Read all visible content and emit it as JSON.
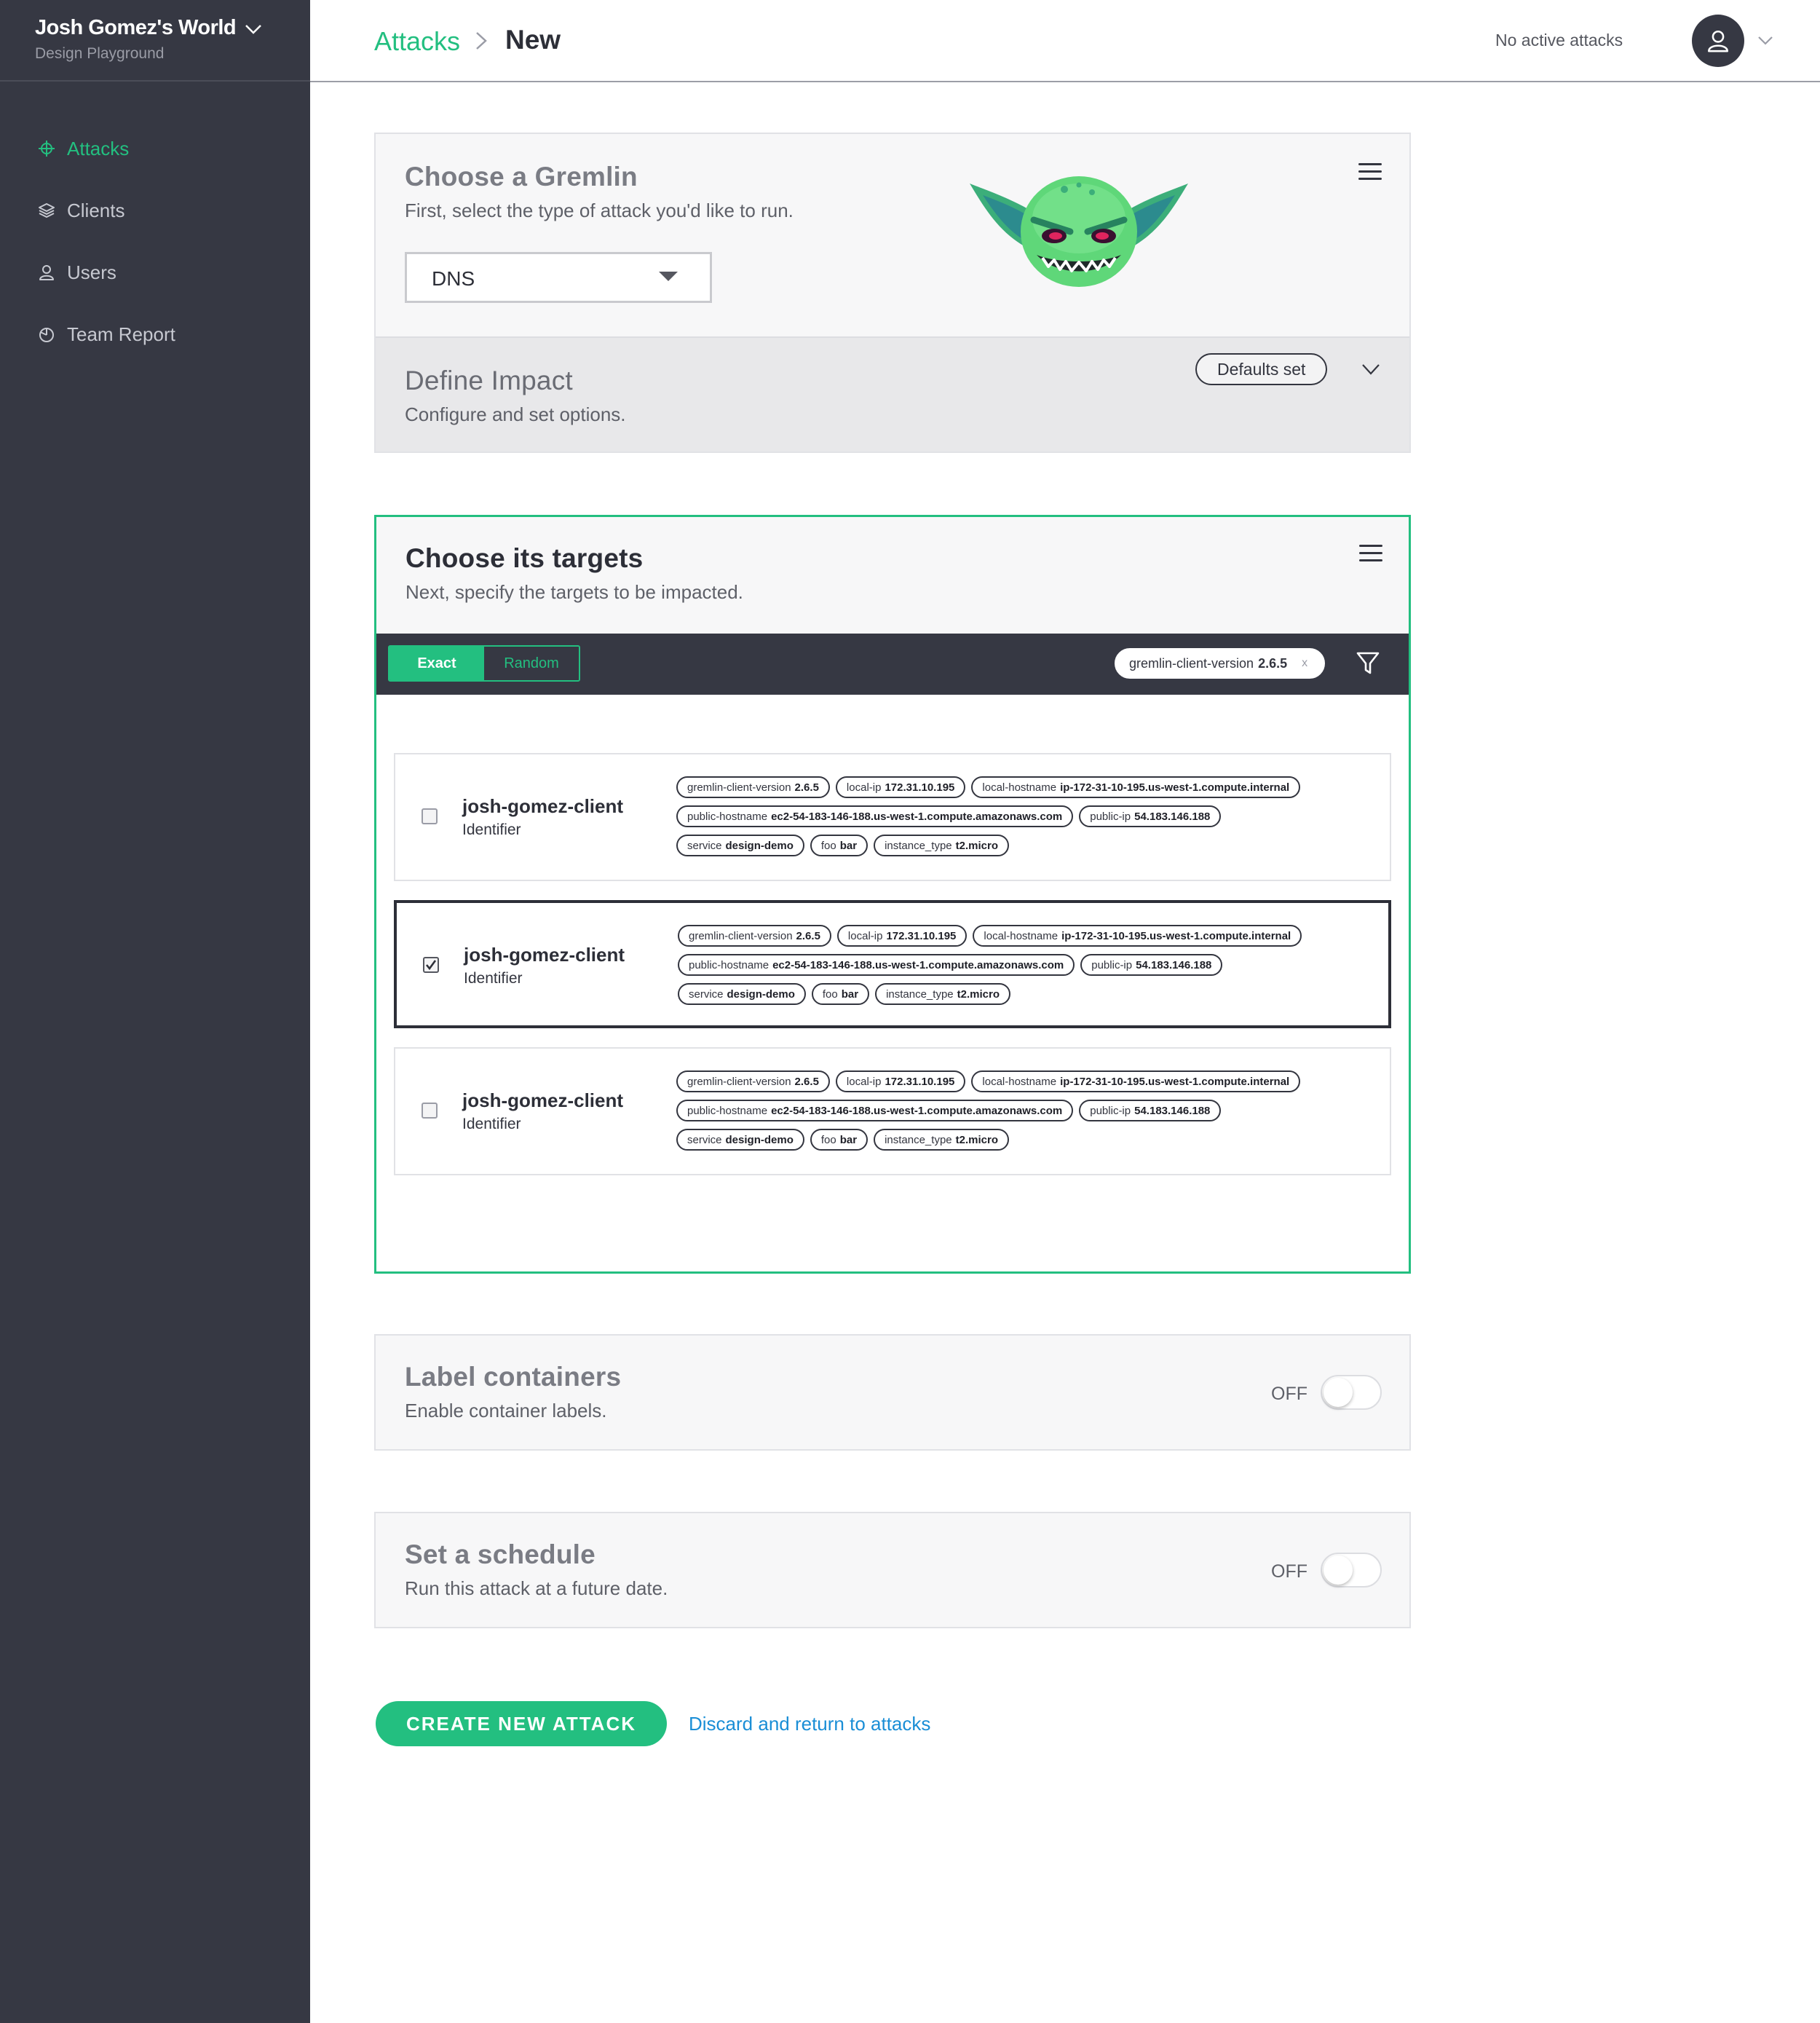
{
  "sidebar": {
    "workspace_title": "Josh Gomez's World",
    "workspace_subtitle": "Design Playground",
    "items": [
      {
        "label": "Attacks",
        "icon": "crosshair-icon",
        "active": true
      },
      {
        "label": "Clients",
        "icon": "layers-icon",
        "active": false
      },
      {
        "label": "Users",
        "icon": "users-icon",
        "active": false
      },
      {
        "label": "Team Report",
        "icon": "pie-chart-icon",
        "active": false
      }
    ]
  },
  "header": {
    "breadcrumb_root": "Attacks",
    "breadcrumb_current": "New",
    "status": "No active attacks",
    "avatar_icon": "user-icon"
  },
  "gremlin_card": {
    "title": "Choose a Gremlin",
    "subtitle": "First, select the type of attack you'd like to run.",
    "selected_type": "DNS",
    "mascot_icon": "gremlin-mascot-icon"
  },
  "impact": {
    "title": "Define Impact",
    "subtitle": "Configure and set options.",
    "badge": "Defaults set"
  },
  "targets_card": {
    "title": "Choose its targets",
    "subtitle": "Next, specify the targets to be impacted.",
    "mode_exact": "Exact",
    "mode_random": "Random",
    "filter_chip": {
      "key": "gremlin-client-version",
      "value": "2.6.5",
      "close": "x"
    },
    "targets": [
      {
        "name": "josh-gomez-client",
        "kind": "Identifier",
        "checked": false,
        "tag_rows": [
          [
            {
              "k": "gremlin-client-version",
              "v": "2.6.5"
            },
            {
              "k": "local-ip",
              "v": "172.31.10.195"
            },
            {
              "k": "local-hostname",
              "v": "ip-172-31-10-195.us-west-1.compute.internal"
            }
          ],
          [
            {
              "k": "public-hostname",
              "v": "ec2-54-183-146-188.us-west-1.compute.amazonaws.com"
            },
            {
              "k": "public-ip",
              "v": "54.183.146.188"
            }
          ],
          [
            {
              "k": "service",
              "v": "design-demo"
            },
            {
              "k": "foo",
              "v": "bar"
            },
            {
              "k": "instance_type",
              "v": "t2.micro"
            }
          ]
        ]
      },
      {
        "name": "josh-gomez-client",
        "kind": "Identifier",
        "checked": true,
        "tag_rows": [
          [
            {
              "k": "gremlin-client-version",
              "v": "2.6.5"
            },
            {
              "k": "local-ip",
              "v": "172.31.10.195"
            },
            {
              "k": "local-hostname",
              "v": "ip-172-31-10-195.us-west-1.compute.internal"
            }
          ],
          [
            {
              "k": "public-hostname",
              "v": "ec2-54-183-146-188.us-west-1.compute.amazonaws.com"
            },
            {
              "k": "public-ip",
              "v": "54.183.146.188"
            }
          ],
          [
            {
              "k": "service",
              "v": "design-demo"
            },
            {
              "k": "foo",
              "v": "bar"
            },
            {
              "k": "instance_type",
              "v": "t2.micro"
            }
          ]
        ]
      },
      {
        "name": "josh-gomez-client",
        "kind": "Identifier",
        "checked": false,
        "tag_rows": [
          [
            {
              "k": "gremlin-client-version",
              "v": "2.6.5"
            },
            {
              "k": "local-ip",
              "v": "172.31.10.195"
            },
            {
              "k": "local-hostname",
              "v": "ip-172-31-10-195.us-west-1.compute.internal"
            }
          ],
          [
            {
              "k": "public-hostname",
              "v": "ec2-54-183-146-188.us-west-1.compute.amazonaws.com"
            },
            {
              "k": "public-ip",
              "v": "54.183.146.188"
            }
          ],
          [
            {
              "k": "service",
              "v": "design-demo"
            },
            {
              "k": "foo",
              "v": "bar"
            },
            {
              "k": "instance_type",
              "v": "t2.micro"
            }
          ]
        ]
      }
    ]
  },
  "labels_card": {
    "title": "Label containers",
    "subtitle": "Enable container labels.",
    "toggle_label": "OFF",
    "enabled": false
  },
  "schedule_card": {
    "title": "Set a schedule",
    "subtitle": "Run this attack at a future date.",
    "toggle_label": "OFF",
    "enabled": false
  },
  "actions": {
    "primary": "CREATE NEW ATTACK",
    "secondary": "Discard and return to attacks"
  },
  "colors": {
    "accent": "#23bf80",
    "sidebar": "#363843",
    "link": "#1a8ed6"
  }
}
